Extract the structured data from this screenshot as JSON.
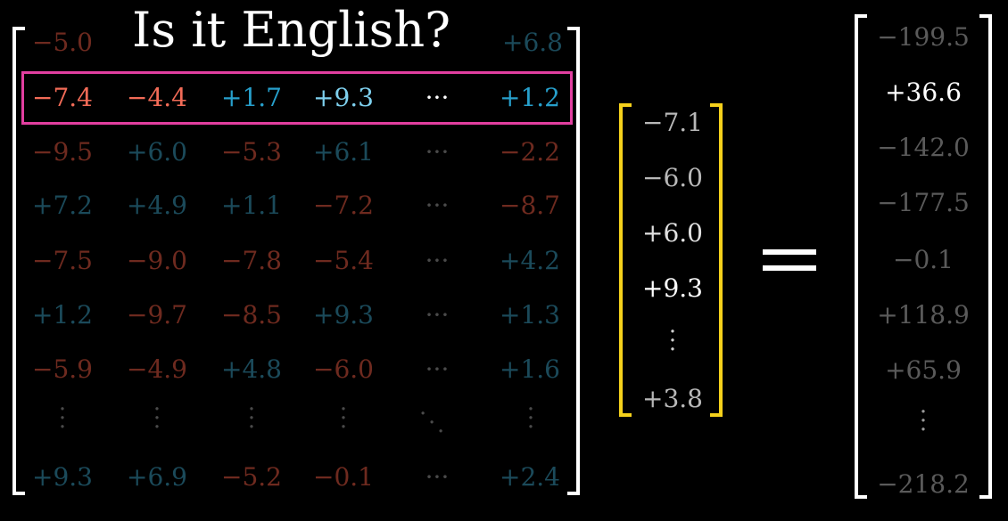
{
  "title": "Is it English?",
  "matrix": {
    "row0": [
      "−5.0",
      "+6.8"
    ],
    "highlight_row": [
      "−7.4",
      "−4.4",
      "+1.7",
      "+9.3",
      "···",
      "+1.2"
    ],
    "rows": [
      [
        "−9.5",
        "+6.0",
        "−5.3",
        "+6.1",
        "···",
        "−2.2"
      ],
      [
        "+7.2",
        "+4.9",
        "+1.1",
        "−7.2",
        "···",
        "−8.7"
      ],
      [
        "−7.5",
        "−9.0",
        "−7.8",
        "−5.4",
        "···",
        "+4.2"
      ],
      [
        "+1.2",
        "−9.7",
        "−8.5",
        "+9.3",
        "···",
        "+1.3"
      ],
      [
        "−5.9",
        "−4.9",
        "+4.8",
        "−6.0",
        "···",
        "+1.6"
      ]
    ],
    "last_row": [
      "+9.3",
      "+6.9",
      "−5.2",
      "−0.1",
      "···",
      "+2.4"
    ]
  },
  "vector": [
    "−7.1",
    "−6.0",
    "+6.0",
    "+9.3",
    "+3.8"
  ],
  "result": [
    "−199.5",
    "+36.6",
    "−142.0",
    "−177.5",
    "−0.1",
    "+118.9",
    "+65.9",
    "−218.2"
  ],
  "colors": {
    "highlight_box": "#e23fa0",
    "vector_bracket": "#f5d11b",
    "bracket": "#ffffff"
  }
}
